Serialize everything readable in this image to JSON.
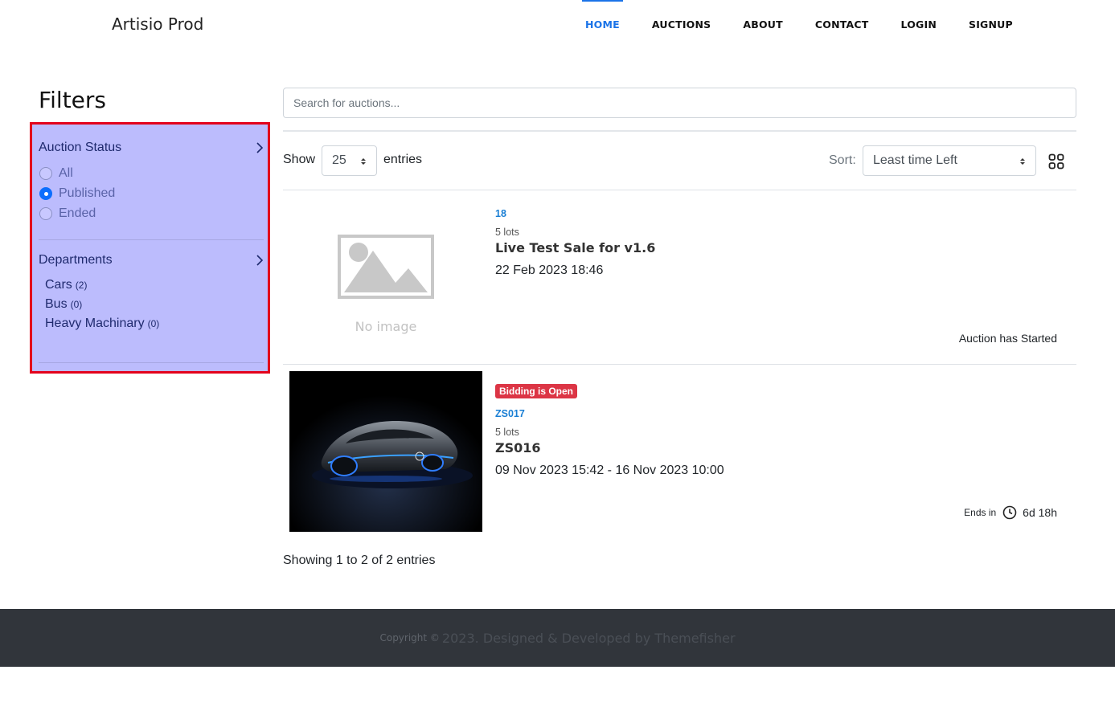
{
  "header": {
    "brand": "Artisio Prod",
    "nav": [
      {
        "label": "HOME",
        "active": true
      },
      {
        "label": "AUCTIONS",
        "active": false
      },
      {
        "label": "ABOUT",
        "active": false
      },
      {
        "label": "CONTACT",
        "active": false
      },
      {
        "label": "LOGIN",
        "active": false
      },
      {
        "label": "SIGNUP",
        "active": false
      }
    ]
  },
  "filters": {
    "title": "Filters",
    "auction_status": {
      "title": "Auction Status",
      "options": [
        {
          "label": "All",
          "checked": false
        },
        {
          "label": "Published",
          "checked": true
        },
        {
          "label": "Ended",
          "checked": false
        }
      ]
    },
    "departments": {
      "title": "Departments",
      "items": [
        {
          "label": "Cars",
          "count": "(2)"
        },
        {
          "label": "Bus",
          "count": "(0)"
        },
        {
          "label": "Heavy Machinary",
          "count": "(0)"
        }
      ]
    }
  },
  "search": {
    "placeholder": "Search for auctions..."
  },
  "controls": {
    "show_label": "Show",
    "entries_value": "25",
    "entries_label": "entries",
    "sort_label": "Sort:",
    "sort_value": "Least time Left"
  },
  "auctions": [
    {
      "code": "18",
      "lots": "5 lots",
      "title": "Live Test Sale for v1.6",
      "date": "22 Feb 2023 18:46",
      "image_text": "No image",
      "status": "Auction has Started"
    },
    {
      "badge": "Bidding is Open",
      "code": "ZS017",
      "lots": "5 lots",
      "title": "ZS016",
      "date": "09 Nov 2023 15:42 - 16 Nov 2023 10:00",
      "ends_label": "Ends in",
      "ends_value": "6d 18h"
    }
  ],
  "pagination": {
    "showing": "Showing 1 to 2 of 2 entries"
  },
  "footer": {
    "small": "Copyright ©",
    "big": "2023. Designed & Developed by Themefisher"
  },
  "colors": {
    "accent": "#1a73e8",
    "filter_panel": "#bcbcfd",
    "highlight_border": "#e3001b",
    "badge": "#dc3545",
    "footer_bg": "#31353b"
  }
}
